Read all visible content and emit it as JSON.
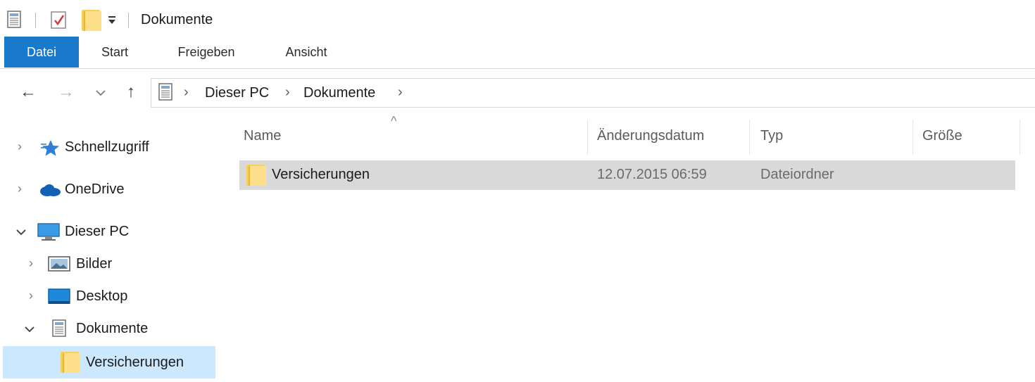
{
  "window": {
    "title": "Dokumente"
  },
  "quick_access": {
    "icons": [
      "properties-icon",
      "checkbox-icon",
      "new-folder-icon",
      "customize-dropdown-icon"
    ]
  },
  "ribbon": {
    "tabs": [
      "Datei",
      "Start",
      "Freigeben",
      "Ansicht"
    ],
    "active_tab": "Datei",
    "accent": "#1979ca"
  },
  "address_bar": {
    "crumbs": [
      "Dieser PC",
      "Dokumente"
    ]
  },
  "nav_pane": {
    "items": [
      {
        "label": "Schnellzugriff",
        "icon": "star-icon",
        "expanded": false
      },
      {
        "label": "OneDrive",
        "icon": "cloud-icon",
        "expanded": false
      },
      {
        "label": "Dieser PC",
        "icon": "computer-icon",
        "expanded": true
      },
      {
        "label": "Bilder",
        "icon": "pictures-folder-icon",
        "expanded": false
      },
      {
        "label": "Desktop",
        "icon": "desktop-folder-icon",
        "expanded": false
      },
      {
        "label": "Dokumente",
        "icon": "documents-icon",
        "expanded": true
      },
      {
        "label": "Versicherungen",
        "icon": "folder-icon",
        "selected": true
      }
    ],
    "selected_color": "#cce8ff"
  },
  "file_list": {
    "columns": [
      "Name",
      "Änderungsdatum",
      "Typ",
      "Größe"
    ],
    "sort_column": "Name",
    "rows": [
      {
        "name": "Versicherungen",
        "modified": "12.07.2015 06:59",
        "type": "Dateiordner",
        "size": ""
      }
    ]
  }
}
